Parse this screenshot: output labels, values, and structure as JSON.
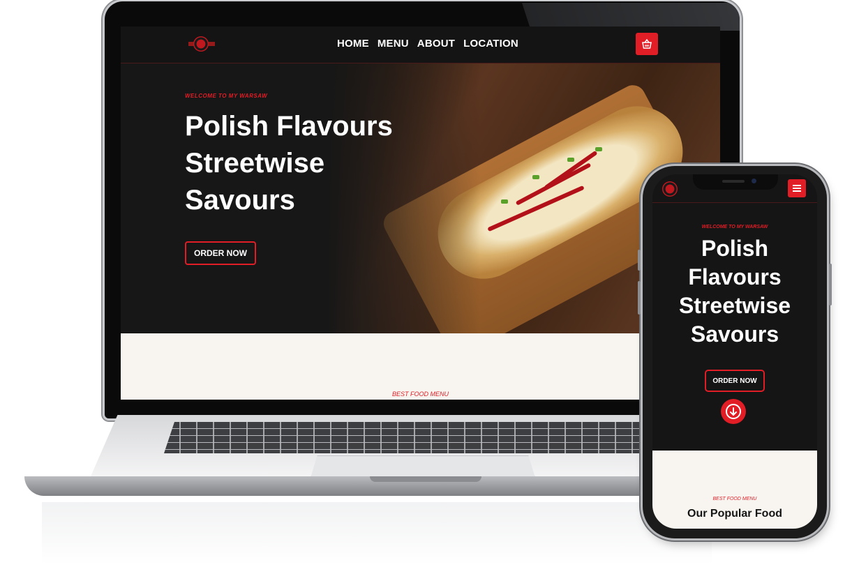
{
  "site": {
    "nav": {
      "links": [
        "HOME",
        "MENU",
        "ABOUT",
        "LOCATION"
      ],
      "cart_icon": "basket-icon",
      "menu_icon": "hamburger-icon"
    },
    "hero": {
      "welcome": "WELCOME TO MY WARSAW",
      "title_desktop": [
        "Polish Flavours",
        "Streetwise",
        "Savours"
      ],
      "title_mobile": [
        "Polish",
        "Flavours",
        "Streetwise",
        "Savours"
      ],
      "order_button": "ORDER NOW",
      "scroll_icon": "arrow-down-circle-icon"
    },
    "menu_section": {
      "eyebrow": "BEST FOOD MENU",
      "heading": "Our Popular Food"
    }
  },
  "colors": {
    "accent": "#e11d26",
    "dark_bg": "#161616",
    "light_bg": "#f8f5f0",
    "text_light": "#ffffff"
  }
}
